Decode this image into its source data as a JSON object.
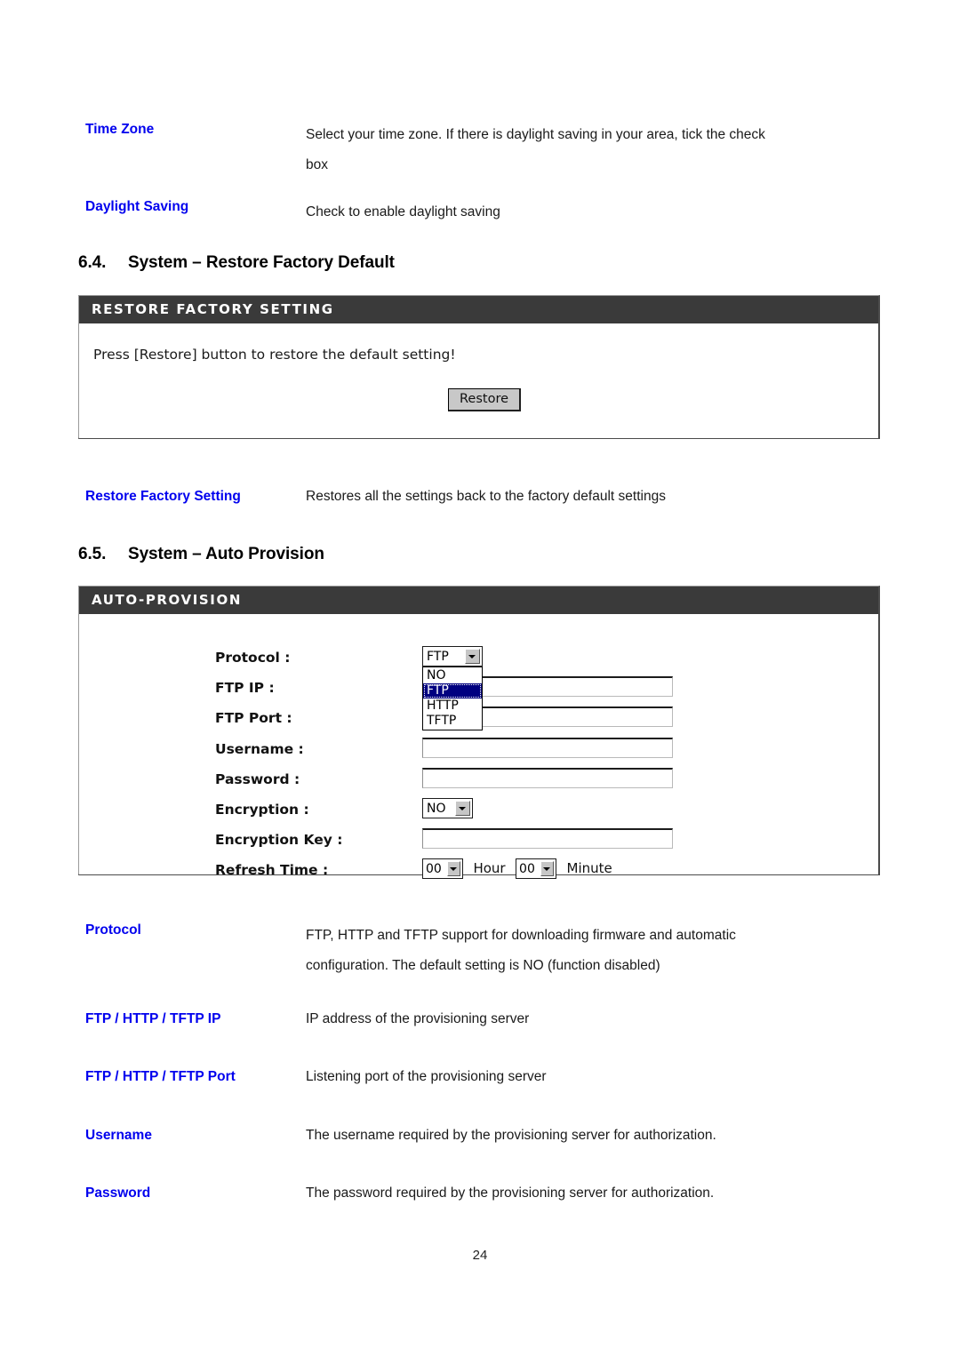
{
  "document": {
    "page_number": "24",
    "accent_color": "#0000ee",
    "panel_header_bg": "#3a3a3a",
    "dropdown_highlight": "#000080"
  },
  "top_descriptions": [
    {
      "label": "Time Zone",
      "lines": [
        "Select your time zone. If there is daylight saving in your area, tick the check",
        "box"
      ]
    },
    {
      "label": "Daylight Saving",
      "lines": [
        "Check to enable daylight saving"
      ]
    }
  ],
  "section_restore": {
    "number": "6.4.",
    "title": "System – Restore Factory Default",
    "panel": {
      "header": "RESTORE FACTORY SETTING",
      "instruction": "Press [Restore] button to restore the default setting!",
      "button_label": "Restore"
    },
    "description": {
      "label": "Restore Factory Setting",
      "lines": [
        "Restores all the settings back to the factory default settings"
      ]
    }
  },
  "section_auto_provision": {
    "number": "6.5.",
    "title": "System – Auto Provision",
    "panel": {
      "header": "AUTO-PROVISION",
      "fields": [
        {
          "label": "Protocol :",
          "type": "select",
          "value": "FTP",
          "name": "protocol"
        },
        {
          "label": "FTP IP :",
          "type": "text",
          "value": "",
          "name": "ftp-ip"
        },
        {
          "label": "FTP Port :",
          "type": "text",
          "value": "",
          "name": "ftp-port"
        },
        {
          "label": "Username :",
          "type": "text",
          "value": "",
          "name": "username"
        },
        {
          "label": "Password :",
          "type": "text",
          "value": "",
          "name": "password"
        },
        {
          "label": "Encryption :",
          "type": "select",
          "value": "NO",
          "name": "encryption"
        },
        {
          "label": "Encryption Key :",
          "type": "text",
          "value": "",
          "name": "encryption-key"
        },
        {
          "label": "Refresh Time :",
          "type": "time",
          "name": "refresh-time"
        }
      ],
      "protocol_options": [
        "NO",
        "FTP",
        "HTTP",
        "TFTP"
      ],
      "protocol_selected": "FTP",
      "refresh_time": {
        "hour_value": "00",
        "hour_unit": "Hour",
        "minute_value": "00",
        "minute_unit": "Minute"
      }
    },
    "descriptions": [
      {
        "label": "Protocol",
        "lines": [
          "FTP, HTTP and TFTP support for downloading firmware and automatic",
          "configuration. The default setting is NO (function disabled)"
        ]
      },
      {
        "label": "FTP / HTTP / TFTP IP",
        "lines": [
          "IP address of the provisioning server"
        ]
      },
      {
        "label": "FTP / HTTP / TFTP Port",
        "lines": [
          "Listening port of the provisioning server"
        ]
      },
      {
        "label": "Username",
        "lines": [
          "The username required by the provisioning server for authorization."
        ]
      },
      {
        "label": "Password",
        "lines": [
          "The password required by the provisioning server for authorization."
        ]
      }
    ]
  }
}
